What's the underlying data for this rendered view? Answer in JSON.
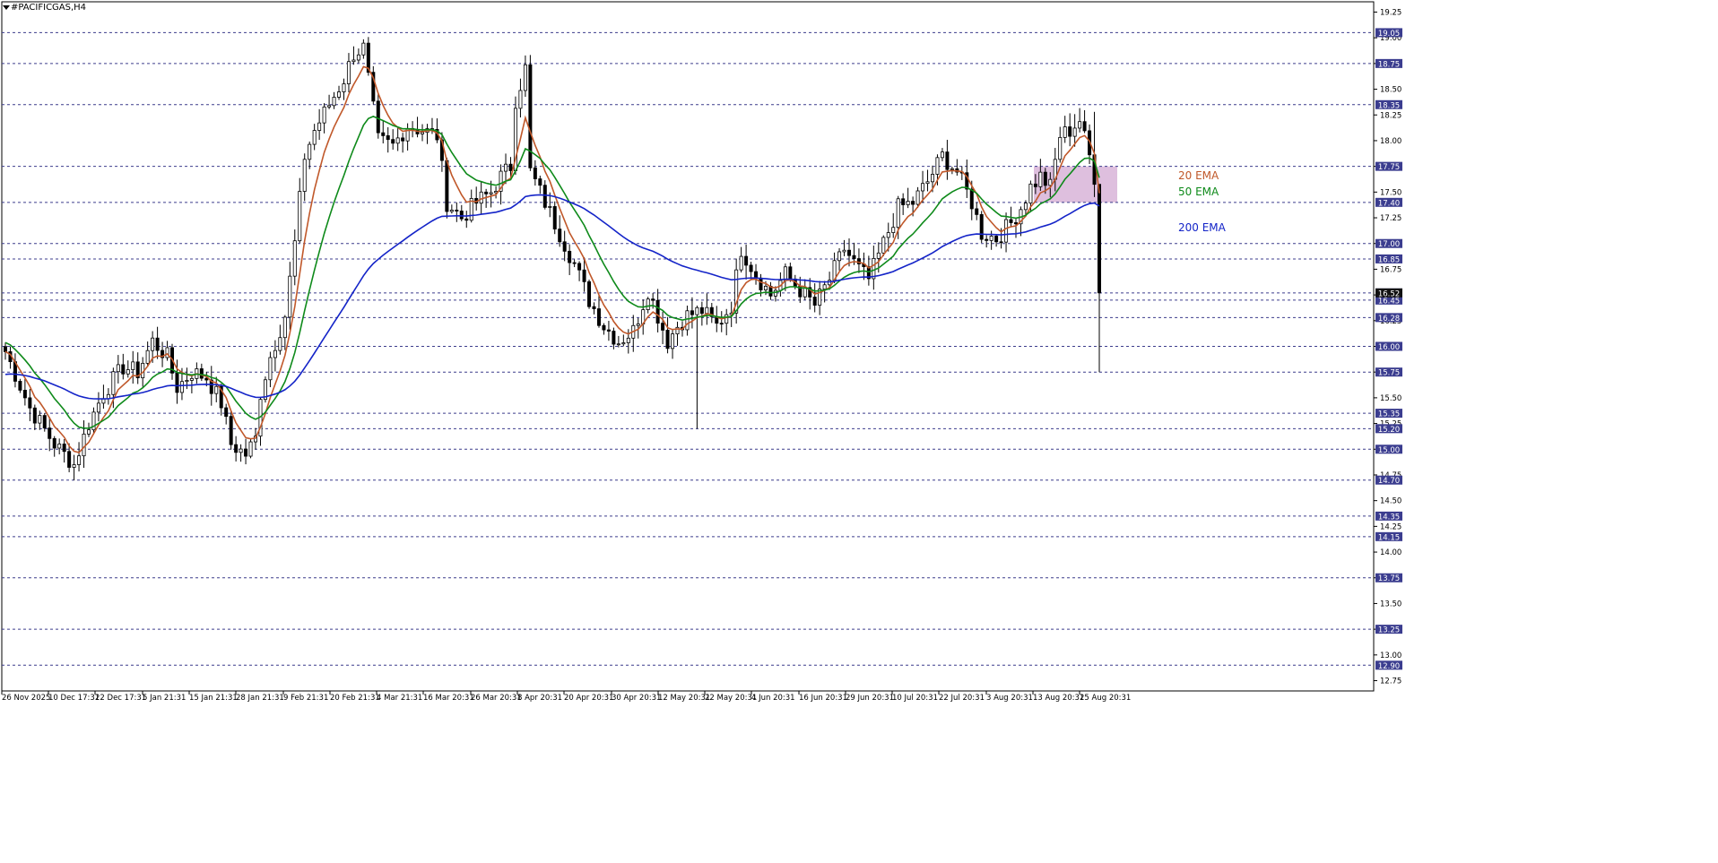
{
  "window": {
    "title": "#PACIFICGAS,H4"
  },
  "chart_data": {
    "type": "candlestick",
    "symbol": "#PACIFICGAS",
    "timeframe": "H4",
    "grid": "none",
    "ylim": [
      12.65,
      19.35
    ],
    "y_ticks": [
      "19.25",
      "19.00",
      "18.75",
      "18.50",
      "18.25",
      "18.00",
      "17.75",
      "17.50",
      "17.25",
      "17.00",
      "16.75",
      "16.50",
      "16.25",
      "16.00",
      "15.75",
      "15.50",
      "15.25",
      "15.00",
      "14.75",
      "14.50",
      "14.25",
      "14.00",
      "13.75",
      "13.50",
      "13.25",
      "13.00",
      "12.75"
    ],
    "x_ticks": [
      "26 Nov 2025",
      "10 Dec 17:31",
      "22 Dec 17:31",
      "5 Jan 21:31",
      "15 Jan 21:31",
      "28 Jan 21:31",
      "9 Feb 21:31",
      "20 Feb 21:31",
      "4 Mar 21:31",
      "16 Mar 20:31",
      "26 Mar 20:31",
      "8 Apr 20:31",
      "20 Apr 20:31",
      "30 Apr 20:31",
      "12 May 20:31",
      "22 May 20:31",
      "4 Jun 20:31",
      "16 Jun 20:31",
      "29 Jun 20:31",
      "10 Jul 20:31",
      "22 Jul 20:31",
      "3 Aug 20:31",
      "13 Aug 20:31",
      "25 Aug 20:31"
    ],
    "levels": [
      "19.05",
      "18.75",
      "18.35",
      "17.75",
      "17.40",
      "17.00",
      "16.85",
      "16.52",
      "16.45",
      "16.28",
      "16.00",
      "15.75",
      "15.35",
      "15.20",
      "15.00",
      "14.70",
      "14.35",
      "14.15",
      "13.75",
      "13.25",
      "12.90"
    ],
    "price_label": "16.52",
    "ema_labels": [
      {
        "name": "20 EMA",
        "color": "#c0582a"
      },
      {
        "name": "50 EMA",
        "color": "#0e8a1a"
      },
      {
        "name": "200 EMA",
        "color": "#1424c8"
      }
    ],
    "zone": {
      "from": 17.4,
      "to": 17.75,
      "start_date": "13 Aug 20:31",
      "color": "#d8b4d8"
    },
    "closes_anchors": [
      [
        0,
        15.95
      ],
      [
        5,
        15.4
      ],
      [
        10,
        15.05
      ],
      [
        14,
        14.85
      ],
      [
        17,
        15.25
      ],
      [
        20,
        15.55
      ],
      [
        24,
        15.8
      ],
      [
        27,
        15.75
      ],
      [
        30,
        16.05
      ],
      [
        33,
        15.9
      ],
      [
        35,
        15.6
      ],
      [
        38,
        15.75
      ],
      [
        41,
        15.7
      ],
      [
        44,
        15.45
      ],
      [
        46,
        15.05
      ],
      [
        49,
        14.95
      ],
      [
        51,
        15.1
      ],
      [
        52,
        15.55
      ],
      [
        54,
        15.9
      ],
      [
        57,
        16.3
      ],
      [
        59,
        17.0
      ],
      [
        61,
        17.85
      ],
      [
        63,
        18.1
      ],
      [
        66,
        18.35
      ],
      [
        69,
        18.6
      ],
      [
        71,
        18.85
      ],
      [
        73,
        18.9
      ],
      [
        74,
        18.6
      ],
      [
        76,
        18.0
      ],
      [
        79,
        17.95
      ],
      [
        82,
        18.15
      ],
      [
        85,
        18.1
      ],
      [
        88,
        18.05
      ],
      [
        90,
        17.4
      ],
      [
        93,
        17.25
      ],
      [
        96,
        17.4
      ],
      [
        99,
        17.5
      ],
      [
        101,
        17.65
      ],
      [
        103,
        17.75
      ],
      [
        104,
        18.4
      ],
      [
        106,
        18.7
      ],
      [
        107,
        17.7
      ],
      [
        110,
        17.4
      ],
      [
        113,
        17.1
      ],
      [
        116,
        16.8
      ],
      [
        119,
        16.45
      ],
      [
        122,
        16.2
      ],
      [
        125,
        16.05
      ],
      [
        128,
        16.15
      ],
      [
        131,
        16.55
      ],
      [
        133,
        16.3
      ],
      [
        135,
        16.05
      ],
      [
        137,
        16.2
      ],
      [
        139,
        16.3
      ],
      [
        142,
        16.35
      ],
      [
        145,
        16.2
      ],
      [
        148,
        16.4
      ],
      [
        150,
        16.95
      ],
      [
        153,
        16.7
      ],
      [
        156,
        16.5
      ],
      [
        159,
        16.7
      ],
      [
        162,
        16.55
      ],
      [
        165,
        16.4
      ],
      [
        168,
        16.65
      ],
      [
        171,
        16.95
      ],
      [
        174,
        16.75
      ],
      [
        176,
        16.65
      ],
      [
        179,
        17.0
      ],
      [
        182,
        17.35
      ],
      [
        185,
        17.4
      ],
      [
        188,
        17.6
      ],
      [
        191,
        17.85
      ],
      [
        194,
        17.7
      ],
      [
        197,
        17.4
      ],
      [
        199,
        17.1
      ],
      [
        202,
        17.05
      ],
      [
        205,
        17.2
      ],
      [
        207,
        17.35
      ],
      [
        209,
        17.55
      ],
      [
        211,
        17.65
      ],
      [
        213,
        17.55
      ],
      [
        215,
        18.05
      ],
      [
        217,
        18.1
      ],
      [
        219,
        18.2
      ],
      [
        221,
        17.85
      ],
      [
        222,
        17.65
      ],
      [
        223,
        16.52
      ]
    ]
  }
}
